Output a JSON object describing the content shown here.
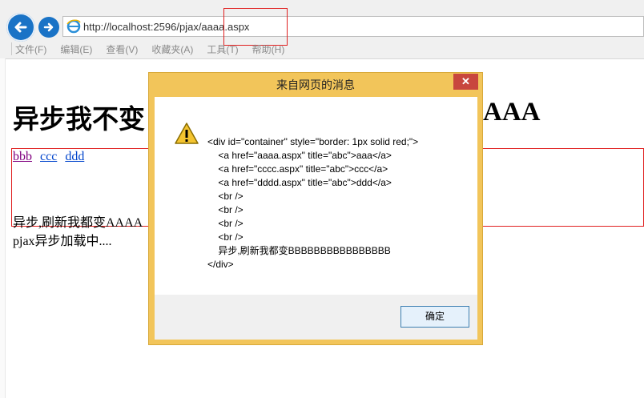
{
  "browser": {
    "url": "http://localhost:2596/pjax/aaaa.aspx",
    "menu": [
      "文件(F)",
      "编辑(E)",
      "查看(V)",
      "收藏夹(A)",
      "工具(T)",
      "帮助(H)"
    ]
  },
  "page": {
    "title_left": "异步我不变",
    "title_right": "AAA",
    "links": [
      {
        "label": "bbb",
        "state": "visited"
      },
      {
        "label": "ccc",
        "state": "unvisited"
      },
      {
        "label": "ddd",
        "state": "unvisited"
      }
    ],
    "async_text": "异步,刷新我都变AAAA",
    "loading_text": "pjax异步加载中...."
  },
  "dialog": {
    "title": "来自网页的消息",
    "close_label": "✕",
    "message": "<div id=\"container\" style=\"border: 1px solid red;\">\n    <a href=\"aaaa.aspx\" title=\"abc\">aaa</a>\n    <a href=\"cccc.aspx\" title=\"abc\">ccc</a>\n    <a href=\"dddd.aspx\" title=\"abc\">ddd</a>\n    <br />\n    <br />\n    <br />\n    <br />\n    异步,刷新我都变BBBBBBBBBBBBBBBB\n</div>",
    "ok_label": "确定",
    "icon": "warning-icon"
  },
  "colors": {
    "accent_blue": "#1a73c6",
    "dialog_frame": "#f2c55a",
    "close_red": "#c8463e",
    "highlight_red": "#e02020"
  }
}
